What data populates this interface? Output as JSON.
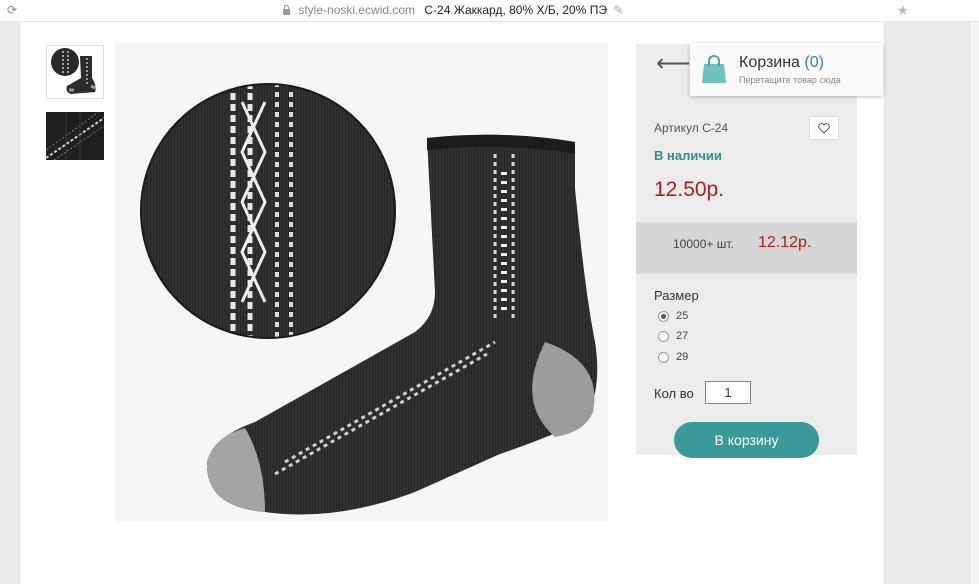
{
  "browser": {
    "reload_icon": "reload-icon",
    "reload_glyph": "⟳",
    "domain": "style-noski.ecwid.com",
    "tab_title": "С-24 Жаккард, 80% Х/Б, 20% ПЭ",
    "bookmark_icon": "star-icon",
    "bookmark_glyph": "★"
  },
  "gallery": {
    "thumbnails": [
      "thumbnail-sock",
      "thumbnail-pattern"
    ]
  },
  "product": {
    "back_glyph": "⟵",
    "sku": "Артикул С-24",
    "stock": "В наличии",
    "price": "12.50р.",
    "bulk_qty": "10000+ шт.",
    "bulk_price": "12.12р.",
    "size_label": "Размер",
    "sizes": [
      "25",
      "27",
      "29"
    ],
    "selected_size": "25",
    "qty_label": "Кол во",
    "qty_value": "1",
    "add_to_cart": "В корзину"
  },
  "cart": {
    "title": "Корзина",
    "count": "(0)",
    "hint": "Перетащите товар сюда"
  },
  "colors": {
    "accent": "#3a9a99",
    "price": "#a81f1f",
    "stock": "#2f8f80",
    "cart_count": "#3a7fc4"
  }
}
